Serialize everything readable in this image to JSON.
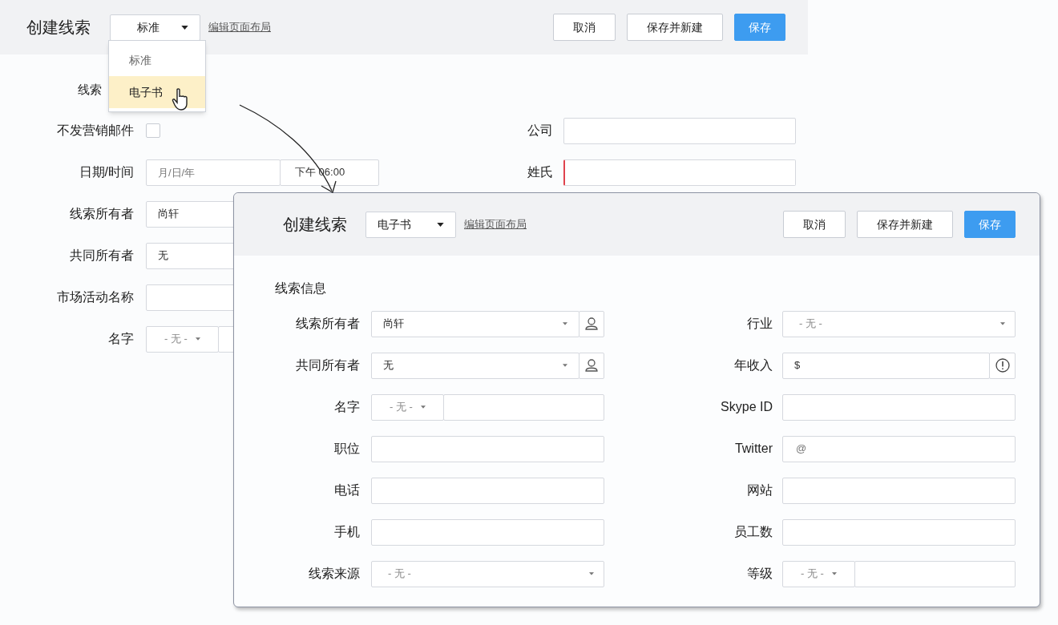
{
  "background_form": {
    "title": "创建线索",
    "layout_select": {
      "value": "标准"
    },
    "edit_layout_link": "编辑页面布局",
    "buttons": [
      {
        "label": "取消",
        "kind": "secondary"
      },
      {
        "label": "保存并新建",
        "kind": "secondary"
      },
      {
        "label": "保存",
        "kind": "primary"
      }
    ],
    "layout_menu": {
      "items": [
        {
          "label": "标准",
          "selected": false
        },
        {
          "label": "电子书",
          "selected": true
        }
      ]
    },
    "section_title": "线索",
    "left_fields": [
      {
        "label": "不发营销邮件",
        "kind": "checkbox",
        "checked": false
      },
      {
        "label": "日期/时间",
        "kind": "datetime",
        "placeholder": "月/日/年",
        "time": "下午 06:00"
      },
      {
        "label": "线索所有者",
        "kind": "text",
        "value": "尚轩"
      },
      {
        "label": "共同所有者",
        "kind": "text",
        "value": "无"
      },
      {
        "label": "市场活动名称",
        "kind": "text"
      },
      {
        "label": "名字",
        "kind": "salutation",
        "placeholder": "- 无 -"
      }
    ],
    "right_fields": [
      {
        "label": "公司",
        "kind": "text",
        "required": false
      },
      {
        "label": "姓氏",
        "kind": "text",
        "required": true
      }
    ]
  },
  "front_form": {
    "title": "创建线索",
    "layout_select": {
      "value": "电子书"
    },
    "edit_layout_link": "编辑页面布局",
    "buttons": [
      {
        "label": "取消",
        "kind": "secondary"
      },
      {
        "label": "保存并新建",
        "kind": "secondary"
      },
      {
        "label": "保存",
        "kind": "primary"
      }
    ],
    "section_title": "线索信息",
    "left_fields": [
      {
        "label": "线索所有者",
        "kind": "lookup",
        "value": "尚轩"
      },
      {
        "label": "共同所有者",
        "kind": "lookup",
        "value": "无"
      },
      {
        "label": "名字",
        "kind": "salutation",
        "placeholder": "- 无 -"
      },
      {
        "label": "职位",
        "kind": "text"
      },
      {
        "label": "电话",
        "kind": "text"
      },
      {
        "label": "手机",
        "kind": "text"
      },
      {
        "label": "线索来源",
        "kind": "select",
        "placeholder": "- 无 -"
      }
    ],
    "right_fields": [
      {
        "label": "行业",
        "kind": "select",
        "placeholder": "- 无 -"
      },
      {
        "label": "年收入",
        "kind": "currency",
        "prefix": "$"
      },
      {
        "label": "Skype ID",
        "kind": "text"
      },
      {
        "label": "Twitter",
        "kind": "prefix",
        "prefix": "@"
      },
      {
        "label": "网站",
        "kind": "text"
      },
      {
        "label": "员工数",
        "kind": "text"
      },
      {
        "label": "等级",
        "kind": "salutation",
        "placeholder": "- 无 -"
      }
    ]
  }
}
